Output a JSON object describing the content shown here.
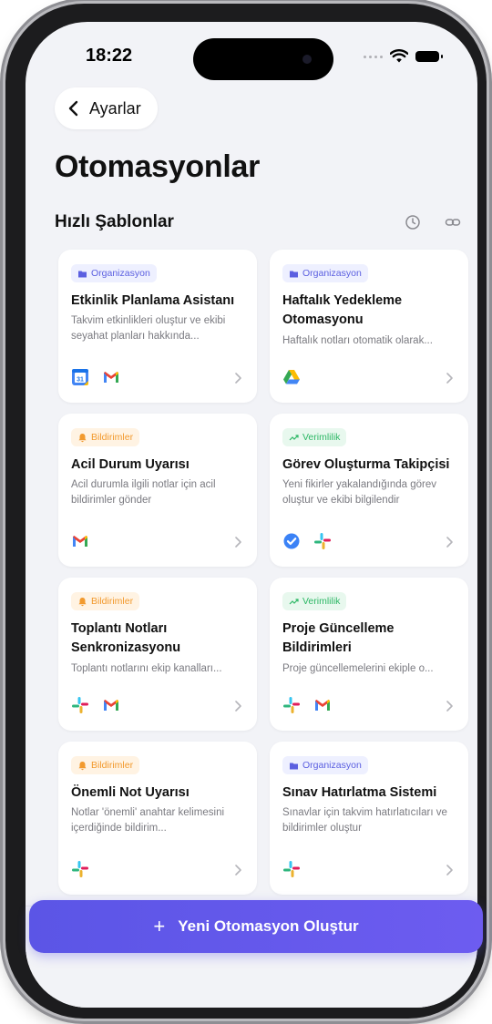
{
  "status_bar": {
    "time": "18:22"
  },
  "nav": {
    "back_label": "Ayarlar"
  },
  "page": {
    "title": "Otomasyonlar"
  },
  "section": {
    "title": "Hızlı Şablonlar",
    "icons": [
      "clock-icon",
      "link-icon"
    ]
  },
  "cards": [
    {
      "badge": "Organizasyon",
      "badge_type": "org",
      "title": "Etkinlik Planlama Asistanı",
      "description": "Takvim etkinlikleri oluştur ve ekibi seyahat planları hakkında...",
      "apps": [
        "google-calendar",
        "gmail"
      ]
    },
    {
      "badge": "Organizasyon",
      "badge_type": "org",
      "title": "Haftalık Yedekleme Otomasyonu",
      "description": "Haftalık notları otomatik olarak...",
      "apps": [
        "google-drive"
      ]
    },
    {
      "badge": "Bildirimler",
      "badge_type": "bild",
      "title": "Acil Durum Uyarısı",
      "description": "Acil durumla ilgili notlar için acil bildirimler gönder",
      "apps": [
        "gmail"
      ]
    },
    {
      "badge": "Verimlilik",
      "badge_type": "ver",
      "title": "Görev Oluşturma Takipçisi",
      "description": "Yeni fikirler yakalandığında görev oluştur ve ekibi bilgilendir",
      "apps": [
        "tasks",
        "slack"
      ]
    },
    {
      "badge": "Bildirimler",
      "badge_type": "bild",
      "title": "Toplantı Notları Senkronizasyonu",
      "description": "Toplantı notlarını ekip kanalları...",
      "apps": [
        "slack",
        "gmail"
      ]
    },
    {
      "badge": "Verimlilik",
      "badge_type": "ver",
      "title": "Proje Güncelleme Bildirimleri",
      "description": "Proje güncellemelerini ekiple o...",
      "apps": [
        "slack",
        "gmail"
      ]
    },
    {
      "badge": "Bildirimler",
      "badge_type": "bild",
      "title": "Önemli Not Uyarısı",
      "description": "Notlar 'önemli' anahtar kelimesini içerdiğinde bildirim...",
      "apps": [
        "slack"
      ]
    },
    {
      "badge": "Organizasyon",
      "badge_type": "org",
      "title": "Sınav Hatırlatma Sistemi",
      "description": "Sınavlar için takvim hatırlatıcıları ve bildirimler oluştur",
      "apps": [
        "slack"
      ]
    }
  ],
  "cta": {
    "plus": "+",
    "label": "Yeni Otomasyon Oluştur"
  },
  "colors": {
    "accent": "#5b55e6",
    "org": "#5b5fe0",
    "bildirimler": "#f29a2e",
    "verimlilik": "#2eb866"
  }
}
